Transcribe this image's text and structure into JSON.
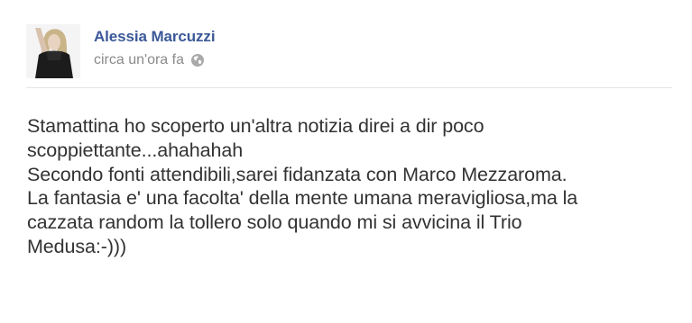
{
  "post": {
    "author_name": "Alessia Marcuzzi",
    "timestamp": "circa un'ora fa",
    "privacy_icon": "globe-icon",
    "lines": [
      "Stamattina ho scoperto un'altra notizia direi a dir poco",
      "scoppiettante...ahahahah",
      "Secondo fonti attendibili,sarei fidanzata con Marco Mezzaroma.",
      "La fantasia e' una facolta' della mente umana meravigliosa,ma la",
      "cazzata random la tollero solo quando mi si avvicina il Trio",
      "Medusa:-)))"
    ]
  },
  "colors": {
    "author": "#3b5998",
    "meta": "#8b8b8b",
    "text": "#333333",
    "divider": "#e5e5e5"
  }
}
